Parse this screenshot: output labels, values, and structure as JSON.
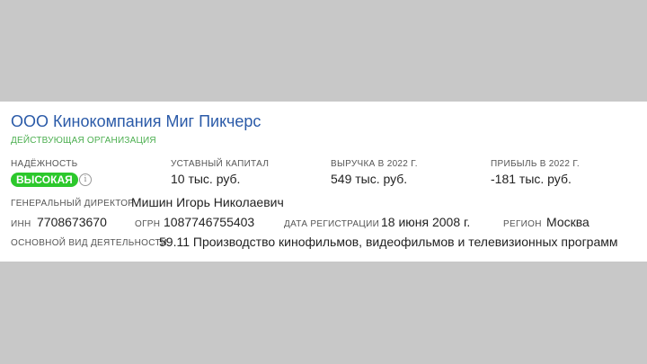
{
  "company": {
    "name": "ООО Кинокомпания Миг Пикчерс",
    "status": "ДЕЙСТВУЮЩАЯ ОРГАНИЗАЦИЯ"
  },
  "metrics": {
    "reliability": {
      "label": "НАДЁЖНОСТЬ",
      "badge": "ВЫСОКАЯ",
      "badge_color": "#2cc82c",
      "icon": "info-icon",
      "icon_glyph": "i"
    },
    "capital": {
      "label": "УСТАВНЫЙ КАПИТАЛ",
      "value": "10 тыс. руб."
    },
    "revenue": {
      "label": "ВЫРУЧКА В 2022 Г.",
      "value": "549 тыс. руб."
    },
    "profit": {
      "label": "ПРИБЫЛЬ В 2022 Г.",
      "value": "-181 тыс. руб."
    }
  },
  "details": {
    "director_label": "ГЕНЕРАЛЬНЫЙ ДИРЕКТОР",
    "director": "Мишин Игорь Николаевич",
    "inn_label": "ИНН",
    "inn": "7708673670",
    "ogrn_label": "ОГРН",
    "ogrn": "1087746755403",
    "reg_date_label": "ДАТА РЕГИСТРАЦИИ",
    "reg_date": "18 июня 2008 г.",
    "region_label": "РЕГИОН",
    "region": "Москва",
    "activity_label": "ОСНОВНОЙ ВИД ДЕЯТЕЛЬНОСТИ",
    "activity": "59.11 Производство кинофильмов, видеофильмов и телевизионных программ"
  },
  "colors": {
    "name_link": "#2a5aa8",
    "status_green": "#4caf50",
    "background": "#c8c8c8"
  }
}
